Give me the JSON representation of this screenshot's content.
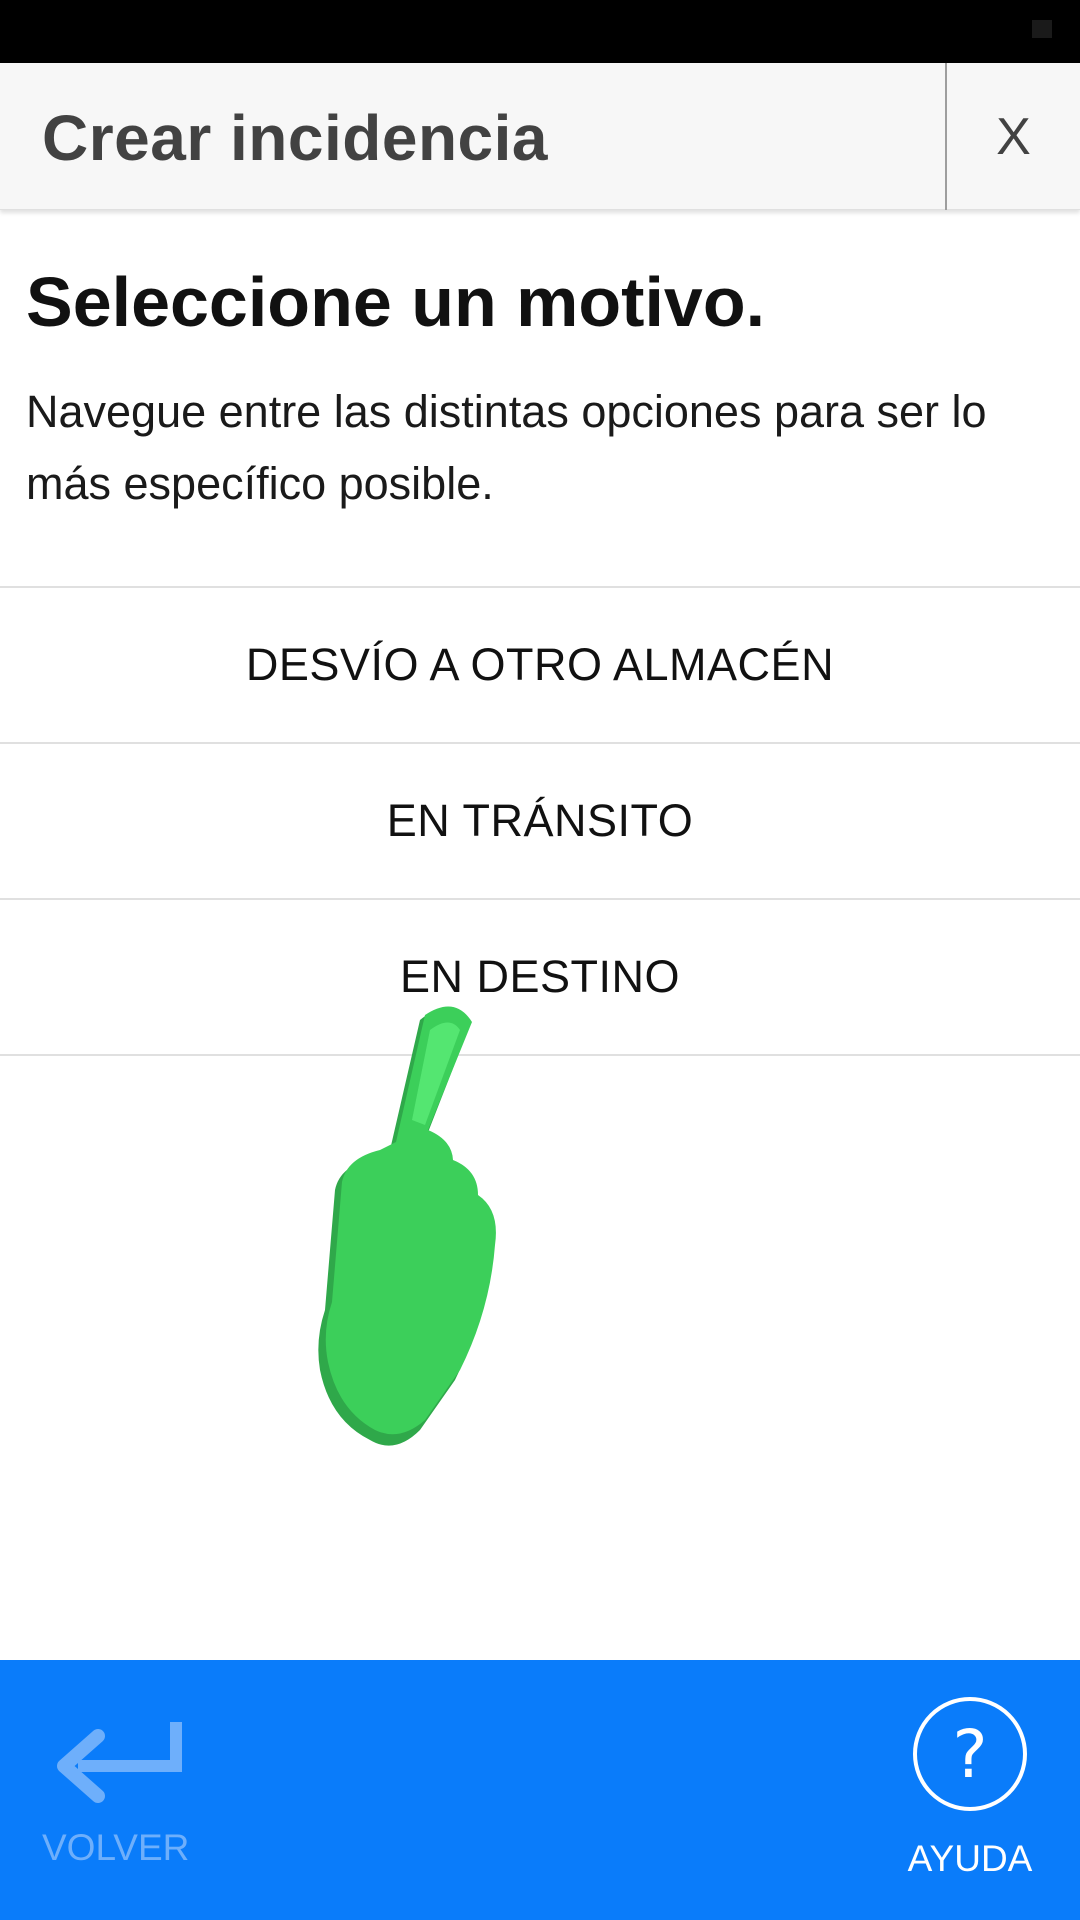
{
  "header": {
    "title": "Crear incidencia",
    "close_label": "X"
  },
  "main": {
    "headline": "Seleccione un motivo.",
    "subtext": "Navegue entre las distintas opciones para ser lo más específico posible.",
    "options": [
      {
        "label": "DESVÍO A OTRO ALMACÉN"
      },
      {
        "label": "EN TRÁNSITO"
      },
      {
        "label": "EN DESTINO"
      }
    ]
  },
  "footer": {
    "back_label": "VOLVER",
    "back_icon": "return-arrow-icon",
    "help_label": "AYUDA",
    "help_icon": "question-circle-icon"
  },
  "overlay": {
    "icon": "hand-pointer-icon",
    "color": "#3ccf5a"
  },
  "colors": {
    "footer_bg": "#0a7cfa",
    "back_disabled": "#6eaffb",
    "header_bg": "#f7f7f7"
  }
}
